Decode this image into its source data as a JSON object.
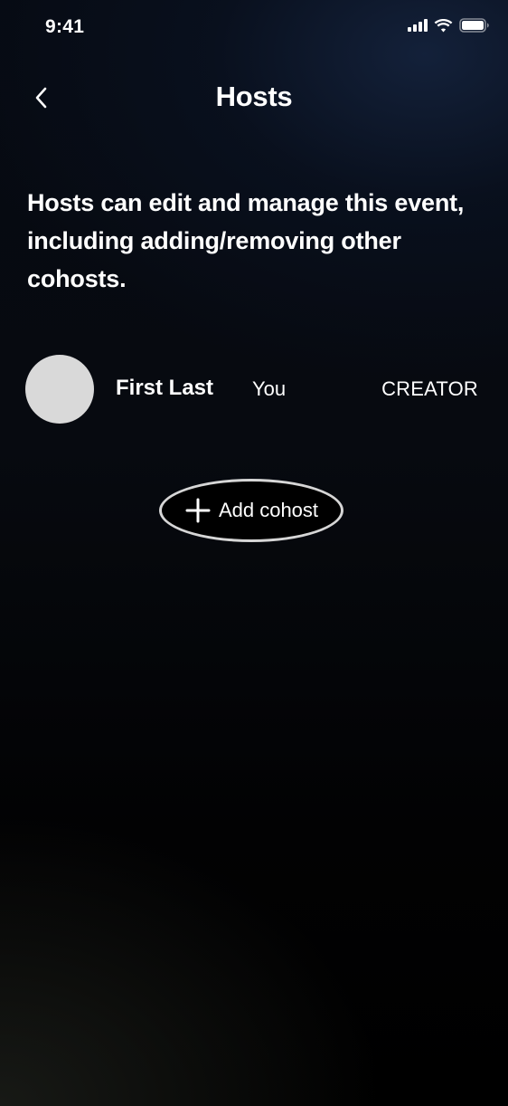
{
  "status_bar": {
    "time": "9:41",
    "icons": [
      "cellular-signal-icon",
      "wifi-icon",
      "battery-icon"
    ]
  },
  "header": {
    "back_icon": "chevron-left-icon",
    "title": "Hosts"
  },
  "description": "Hosts can edit and manage this event, including adding/removing other cohosts.",
  "hosts": [
    {
      "name": "First Last",
      "tag": "You",
      "role": "CREATOR"
    }
  ],
  "add_cohost": {
    "icon": "plus-icon",
    "label": "Add cohost"
  },
  "colors": {
    "background_top": "#0a1424",
    "background_bottom": "#000000",
    "text": "#ffffff",
    "avatar": "#d9d9d9",
    "button_border": "#d6d6d6"
  }
}
